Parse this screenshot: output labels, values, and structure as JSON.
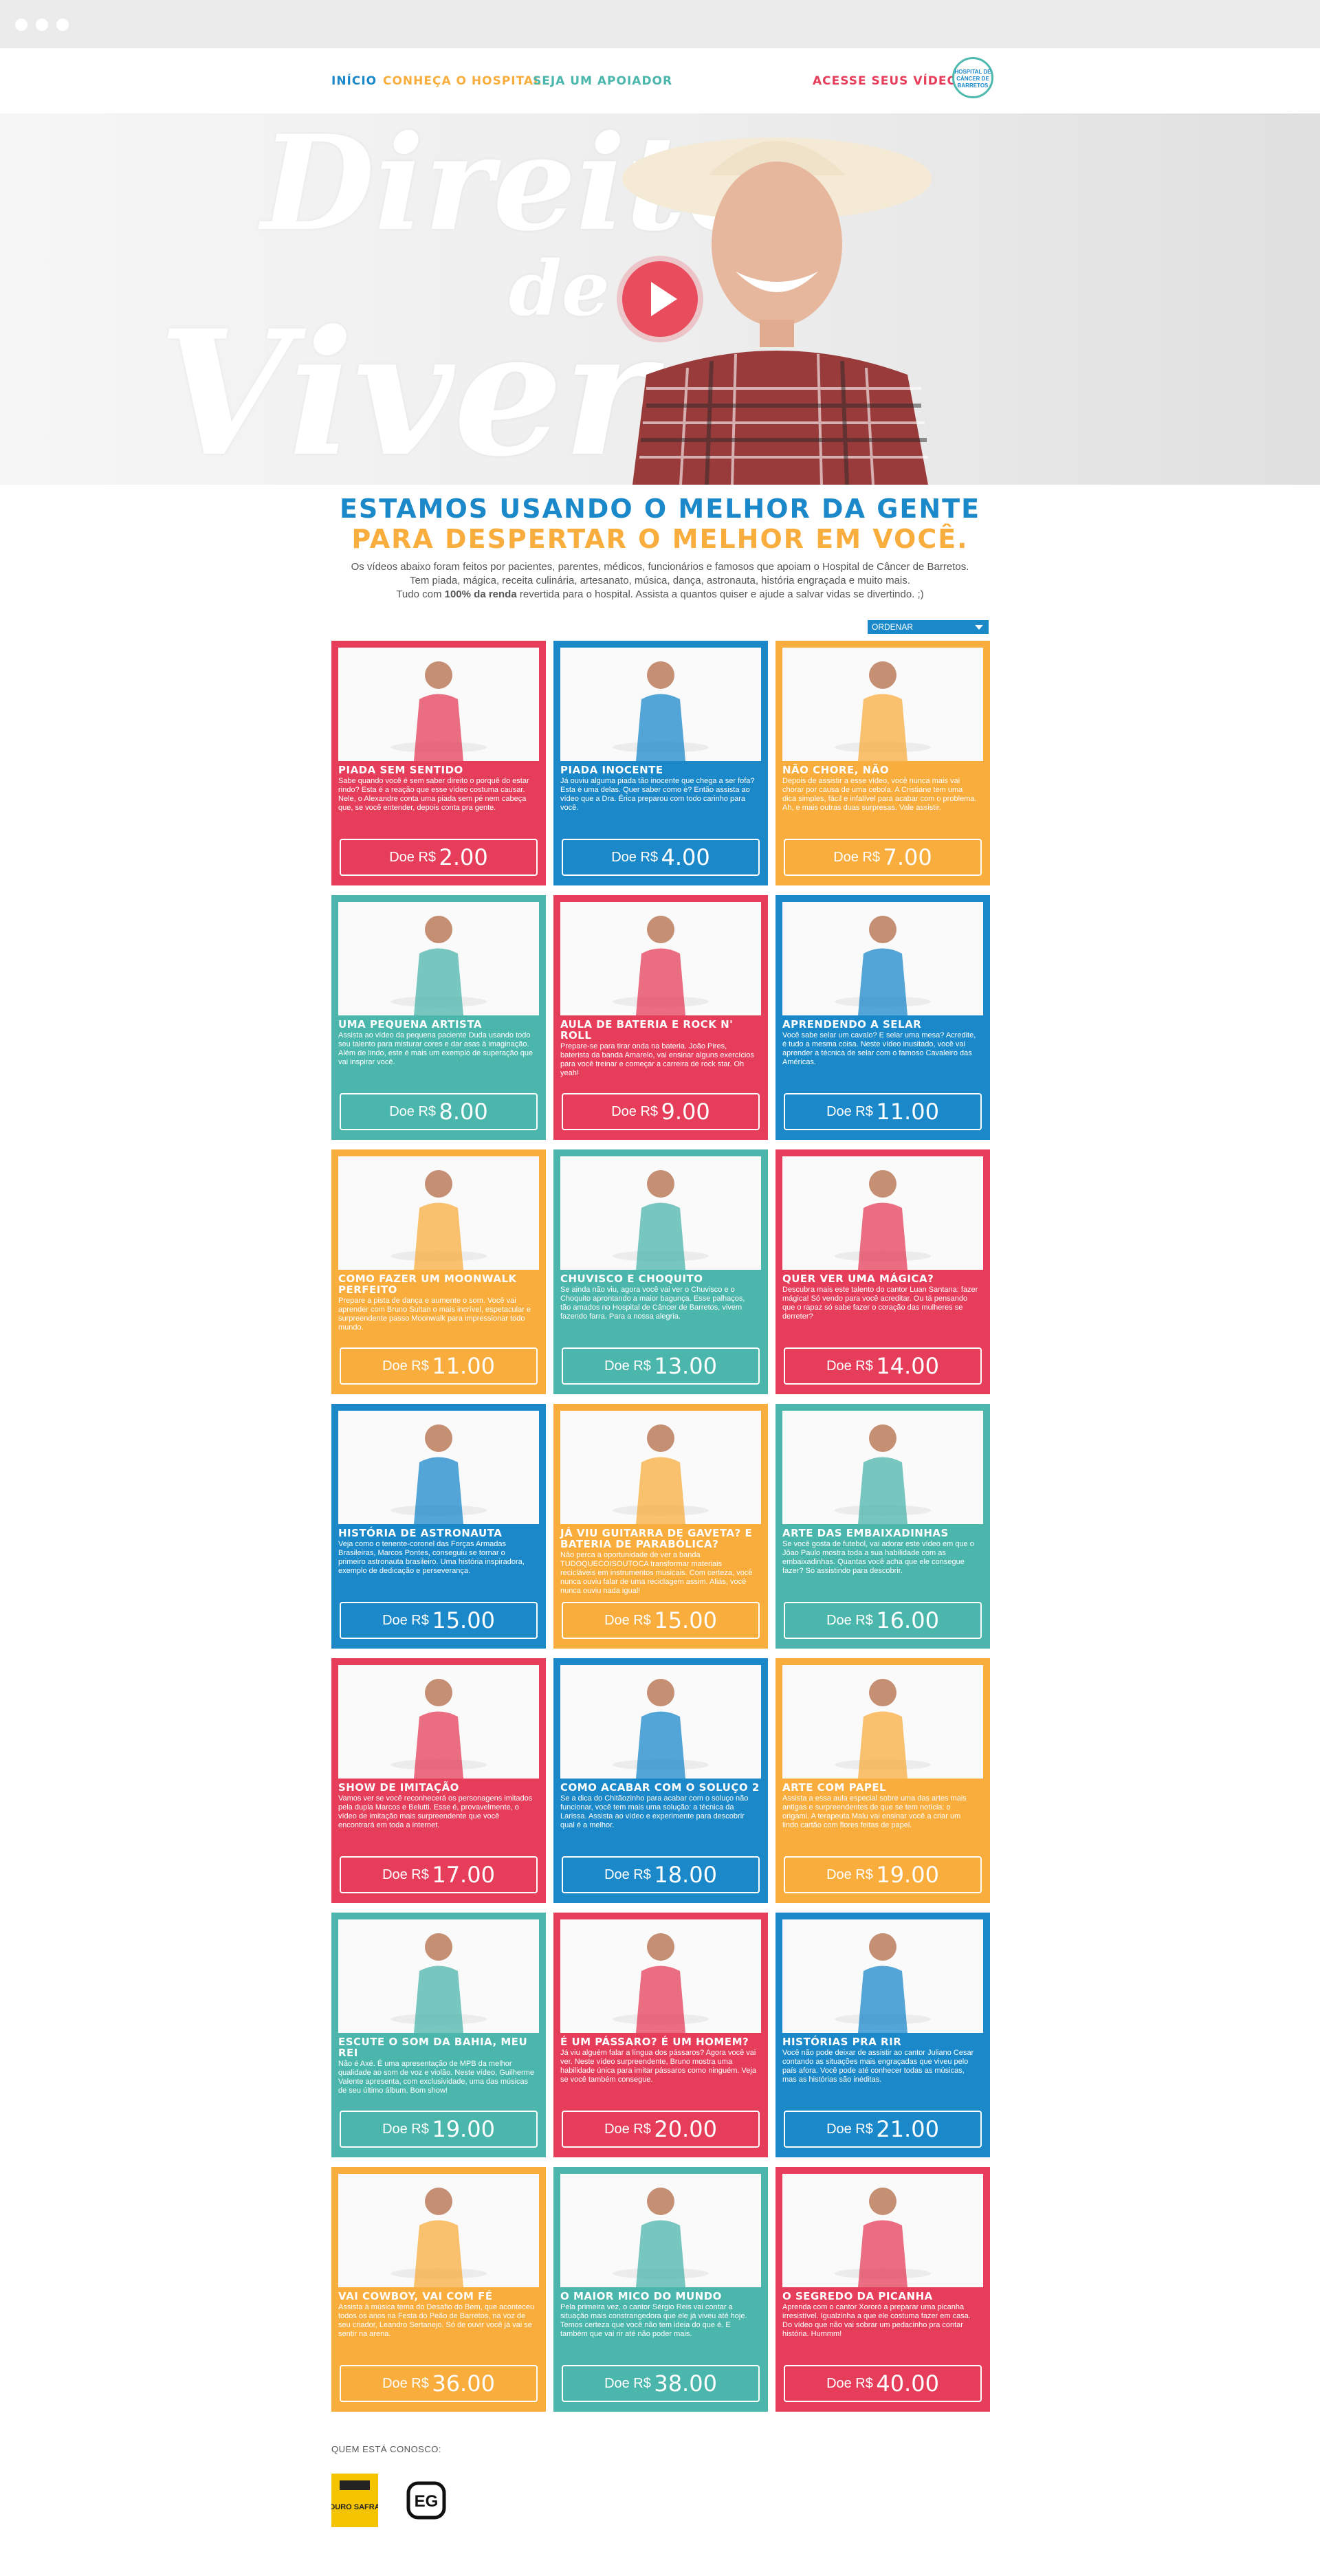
{
  "nav": {
    "inicio": "INÍCIO",
    "conheca": "CONHEÇA O HOSPITAL",
    "apoiador": "SEJA UM APOIADOR",
    "videos": "ACESSE SEUS VÍDEOS",
    "logo_text": "HOSPITAL DE CÂNCER DE BARRETOS"
  },
  "hero": {
    "script_line1": "Direito",
    "script_line2": "de",
    "script_line3": "Viver"
  },
  "headline": {
    "line1": "ESTAMOS USANDO O MELHOR DA GENTE",
    "line2": "PARA DESPERTAR O MELHOR EM VOCÊ."
  },
  "intro": {
    "line1": "Os vídeos abaixo foram feitos por pacientes, parentes, médicos, funcionários e famosos que apoiam o Hospital de Câncer de Barretos.",
    "line2": "Tem piada, mágica, receita culinária, artesanato, música, dança, astronauta, história engraçada e muito mais.",
    "line3_a": "Tudo com ",
    "line3_b": "100% da renda",
    "line3_c": " revertida para o hospital. Assista a quantos quiser e ajude a salvar vidas se divertindo. ;)"
  },
  "sort_label": "ORDENAR",
  "donate_prefix": "Doe R$",
  "colors": {
    "red": "#e63d5a",
    "blue": "#1a88c9",
    "orange": "#f8ad3d",
    "teal": "#4bb6ac"
  },
  "cards": [
    {
      "title": "PIADA SEM SENTIDO",
      "desc": "Sabe quando você é sem saber direito o porquê do estar rindo? Esta é a reação que esse vídeo costuma causar. Nele, o Alexandre conta uma piada sem pé nem cabeça que, se você entender, depois conta pra gente.",
      "amount": "2.00",
      "color": "red"
    },
    {
      "title": "PIADA INOCENTE",
      "desc": "Já ouviu alguma piada tão inocente que chega a ser fofa? Esta é uma delas. Quer saber como é? Então assista ao vídeo que a Dra. Érica preparou com todo carinho para você.",
      "amount": "4.00",
      "color": "blue"
    },
    {
      "title": "NÃO CHORE, NÃO",
      "desc": "Depois de assistir a esse vídeo, você nunca mais vai chorar por causa de uma cebola. A Cristiane tem uma dica simples, fácil e infalível para acabar com o problema. Ah, e mais outras duas surpresas. Vale assistir.",
      "amount": "7.00",
      "color": "orange"
    },
    {
      "title": "UMA PEQUENA ARTISTA",
      "desc": "Assista ao vídeo da pequena paciente Duda usando todo seu talento para misturar cores e dar asas à imaginação. Além de lindo, este é mais um exemplo de superação que vai inspirar você.",
      "amount": "8.00",
      "color": "teal"
    },
    {
      "title": "AULA DE BATERIA E ROCK N' ROLL",
      "desc": "Prepare-se para tirar onda na bateria. João Pires, baterista da banda Amarelo, vai ensinar alguns exercícios para você treinar e começar a carreira de rock star. Oh yeah!",
      "amount": "9.00",
      "color": "red"
    },
    {
      "title": "APRENDENDO A SELAR",
      "desc": "Você sabe selar um cavalo? E selar uma mesa? Acredite, é tudo a mesma coisa. Neste vídeo inusitado, você vai aprender a técnica de selar com o famoso Cavaleiro das Américas.",
      "amount": "11.00",
      "color": "blue"
    },
    {
      "title": "COMO FAZER UM MOONWALK PERFEITO",
      "desc": "Prepare a pista de dança e aumente o som. Você vai aprender com Bruno Sultan o mais incrível, espetacular e surpreendente passo Moonwalk para impressionar todo mundo.",
      "amount": "11.00",
      "color": "orange"
    },
    {
      "title": "CHUVISCO E CHOQUITO",
      "desc": "Se ainda não viu, agora você vai ver o Chuvisco e o Choquito aprontando a maior bagunça. Esse palhaços, tão amados no Hospital de Câncer de Barretos, vivem fazendo farra. Para a nossa alegria.",
      "amount": "13.00",
      "color": "teal"
    },
    {
      "title": "QUER VER UMA MÁGICA?",
      "desc": "Descubra mais este talento do cantor Luan Santana: fazer mágica! Só vendo para você acreditar. Ou tá pensando que o rapaz só sabe fazer o coração das mulheres se derreter?",
      "amount": "14.00",
      "color": "red"
    },
    {
      "title": "HISTÓRIA DE ASTRONAUTA",
      "desc": "Veja como o tenente-coronel das Forças Armadas Brasileiras, Marcos Pontes, conseguiu se tornar o primeiro astronauta brasileiro. Uma história inspiradora, exemplo de dedicação e perseverança.",
      "amount": "15.00",
      "color": "blue"
    },
    {
      "title": "JÁ VIU GUITARRA DE GAVETA? E BATERIA DE PARABÓLICA?",
      "desc": "Não perca a oportunidade de ver a banda TUDOQUECOISOUTOCA transformar materiais recicláveis em instrumentos musicais. Com certeza, você nunca ouviu falar de uma reciclagem assim. Aliás, você nunca ouviu nada igual!",
      "amount": "15.00",
      "color": "orange"
    },
    {
      "title": "ARTE DAS EMBAIXADINHAS",
      "desc": "Se você gosta de futebol, vai adorar este vídeo em que o Jôao Paulo mostra toda a sua habilidade com as embaixadinhas. Quantas você acha que ele consegue fazer? Só assistindo para descobrir.",
      "amount": "16.00",
      "color": "teal"
    },
    {
      "title": "SHOW DE IMITAÇÃO",
      "desc": "Vamos ver se você reconhecerá os personagens imitados pela dupla Marcos e Belutti. Esse é, provavelmente, o vídeo de imitação mais surpreendente que você encontrará em toda a internet.",
      "amount": "17.00",
      "color": "red"
    },
    {
      "title": "COMO ACABAR COM O SOLUÇO 2",
      "desc": "Se a dica do Chitãozinho para acabar com o soluço não funcionar, você tem mais uma solução: a técnica da Larissa. Assista ao vídeo e experimente para descobrir qual é a melhor.",
      "amount": "18.00",
      "color": "blue"
    },
    {
      "title": "ARTE COM PAPEL",
      "desc": "Assista a essa aula especial sobre uma das artes mais antigas e surpreendentes de que se tem notícia: o origami. A terapeuta Malu vai ensinar você a criar um lindo cartão com flores feitas de papel.",
      "amount": "19.00",
      "color": "orange"
    },
    {
      "title": "ESCUTE O SOM DA BAHIA, MEU REI",
      "desc": "Não é Axé. É uma apresentação de MPB da melhor qualidade ao som de voz e violão. Neste vídeo, Guilherme Valente apresenta, com exclusividade, uma das músicas de seu último álbum. Bom show!",
      "amount": "19.00",
      "color": "teal"
    },
    {
      "title": "É UM PÁSSARO? É UM HOMEM?",
      "desc": "Já viu alguém falar a língua dos pássaros? Agora você vai ver. Neste vídeo surpreendente, Bruno mostra uma habilidade única para imitar pássaros como ninguém. Veja se você também consegue.",
      "amount": "20.00",
      "color": "red"
    },
    {
      "title": "HISTÓRIAS PRA RIR",
      "desc": "Você não pode deixar de assistir ao cantor Juliano Cesar contando as situações mais engraçadas que viveu pelo país afora. Você pode até conhecer todas as músicas, mas as histórias são inéditas.",
      "amount": "21.00",
      "color": "blue"
    },
    {
      "title": "VAI COWBOY, VAI COM FÉ",
      "desc": "Assista à música tema do Desafio do Bem, que aconteceu todos os anos na Festa do Peão de Barretos, na voz de seu criador, Leandro Sertanejo. Só de ouvir você já vai se sentir na arena.",
      "amount": "36.00",
      "color": "orange"
    },
    {
      "title": "O MAIOR MICO DO MUNDO",
      "desc": "Pela primeira vez, o cantor Sérgio Reis vai contar a situação mais constrangedora que ele já viveu até hoje. Temos certeza que você não tem ideia do que é. E também que vai rir até não poder mais.",
      "amount": "38.00",
      "color": "teal"
    },
    {
      "title": "O SEGREDO DA PICANHA",
      "desc": "Aprenda com o cantor Xororó a preparar uma picanha irresistível. Igualzinha a que ele costuma fazer em casa. Do vídeo que não vai sobrar um pedacinho pra contar história. Hummm!",
      "amount": "40.00",
      "color": "red"
    }
  ],
  "partners": {
    "label": "QUEM ESTÁ CONOSCO:",
    "logo1": "DURO SAFRA",
    "logo2": "EG"
  }
}
